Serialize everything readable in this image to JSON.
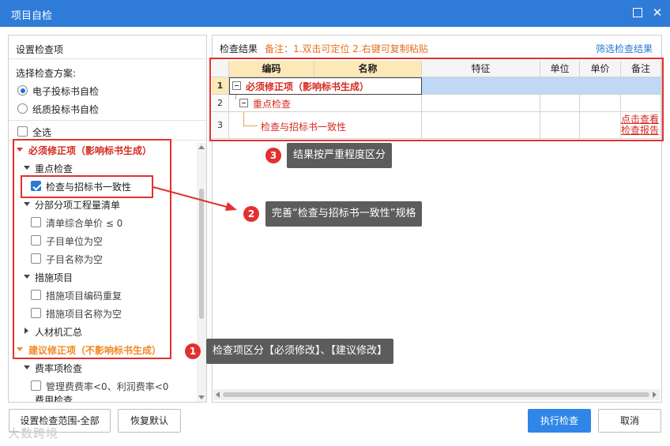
{
  "window": {
    "title": "项目自检",
    "max_icon": "maximize-icon",
    "close_icon": "close-icon",
    "close_glyph": "✕"
  },
  "left": {
    "header": "设置检查项",
    "scheme_label": "选择检查方案:",
    "scheme_options": [
      "电子投标书自检",
      "纸质投标书自检"
    ],
    "select_all": "全选",
    "tree": {
      "must_group": "必须修正项（影响标书生成）",
      "key_check": "重点检查",
      "key_item": "检查与招标书一致性",
      "section": "分部分项工程量清单",
      "section_items": [
        "清单综合单价 ≤ 0",
        "子目单位为空",
        "子目名称为空"
      ],
      "measures": "措施项目",
      "measures_items": [
        "措施项目编码重复",
        "措施项目名称为空"
      ],
      "materials": "人材机汇总",
      "suggest_group": "建议修正项（不影响标书生成）",
      "fee": "费率项检查",
      "fee_item": "管理费费率<0、利润费率<0",
      "cut_off": "费用检查"
    }
  },
  "right": {
    "title": "检查结果",
    "note": "备注：1.双击可定位 2.右键可复制粘贴",
    "filter_link": "筛选检查结果",
    "columns": [
      "编码",
      "名称",
      "特征",
      "单位",
      "单价",
      "备注"
    ],
    "rows": [
      {
        "num": "1",
        "name": "必须修正项（影响标书生成）"
      },
      {
        "num": "2",
        "name": "重点检查"
      },
      {
        "num": "3",
        "name": "检查与招标书一致性",
        "remark_lines": [
          "点击查看",
          "检查报告"
        ]
      }
    ]
  },
  "buttons": {
    "set_range": "设置检查范围-全部",
    "restore": "恢复默认",
    "run": "执行检查",
    "cancel": "取消"
  },
  "callouts": [
    {
      "num": "1",
      "text": "检查项区分【必须修改】、【建议修改】"
    },
    {
      "num": "2",
      "text": "完善“检查与招标书一致性”规格"
    },
    {
      "num": "3",
      "text": "结果按严重程度区分"
    }
  ],
  "watermark": "大数跨境",
  "colors": {
    "titlebar": "#2f7bd8",
    "must_red": "#d42a1f",
    "suggest_orange": "#f08a24",
    "annotation_red": "#e2312f",
    "primary_button": "#2f86e6",
    "row_highlight": "#bed8f5"
  }
}
